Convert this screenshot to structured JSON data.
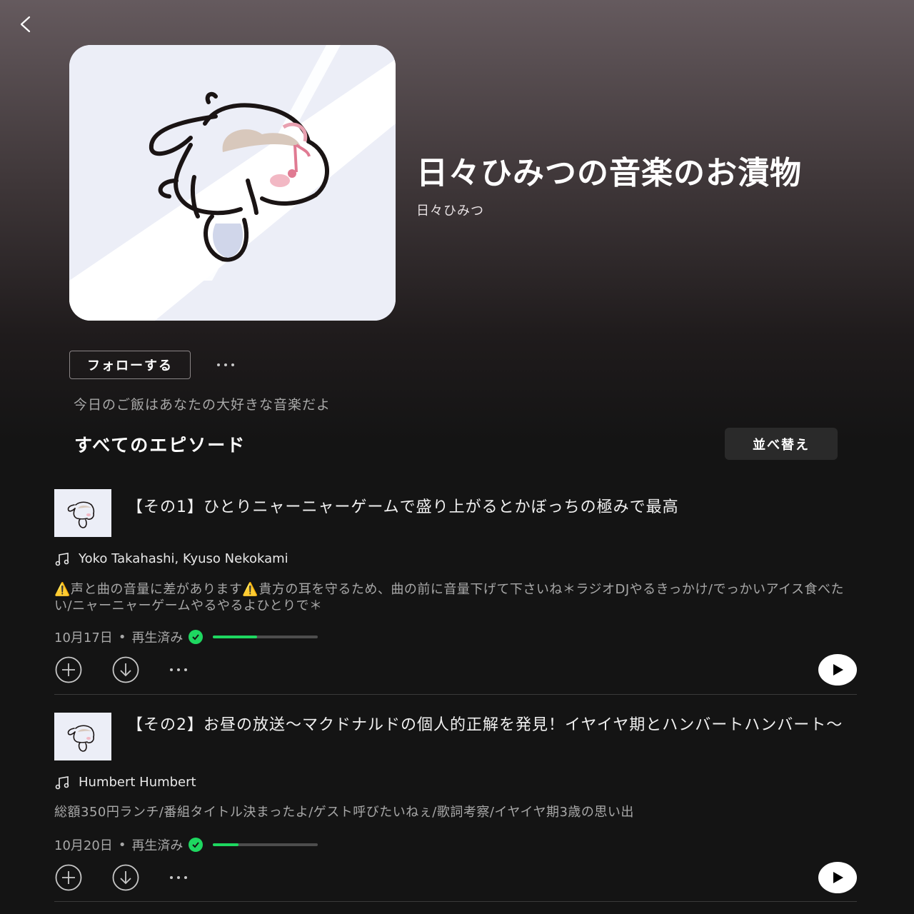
{
  "header": {
    "back_icon": "chevron-left-icon"
  },
  "show": {
    "title": "日々ひみつの音楽のお漬物",
    "author": "日々ひみつ",
    "follow_label": "フォローする",
    "description": "今日のご飯はあなたの大好きな音楽だよ"
  },
  "episodes_section": {
    "title": "すべてのエピソード",
    "sort_label": "並べ替え"
  },
  "episodes": [
    {
      "title": "【その1】ひとりニャーニャーゲームで盛り上がるとかぼっちの極みで最高",
      "artists": "Yoko Takahashi, Kyuso Nekokami",
      "description": "⚠️声と曲の音量に差があります⚠️貴方の耳を守るため、曲の前に音量下げて下さいね＊ラジオDJやるきっかけ/でっかいアイス食べたい/ニャーニャーゲームやるやるよひとりで＊",
      "date": "10月17日",
      "status": "再生済み",
      "progress": 0.42
    },
    {
      "title": "【その2】お昼の放送〜マクドナルドの個人的正解を発見！イヤイヤ期とハンバートハンバート〜",
      "artists": "Humbert Humbert",
      "description": "総額350円ランチ/番組タイトル決まったよ/ゲスト呼びたいねぇ/歌詞考察/イヤイヤ期3歳の思い出",
      "date": "10月20日",
      "status": "再生済み",
      "progress": 0.24
    }
  ],
  "colors": {
    "accent": "#1ed760",
    "background": "#141414"
  }
}
